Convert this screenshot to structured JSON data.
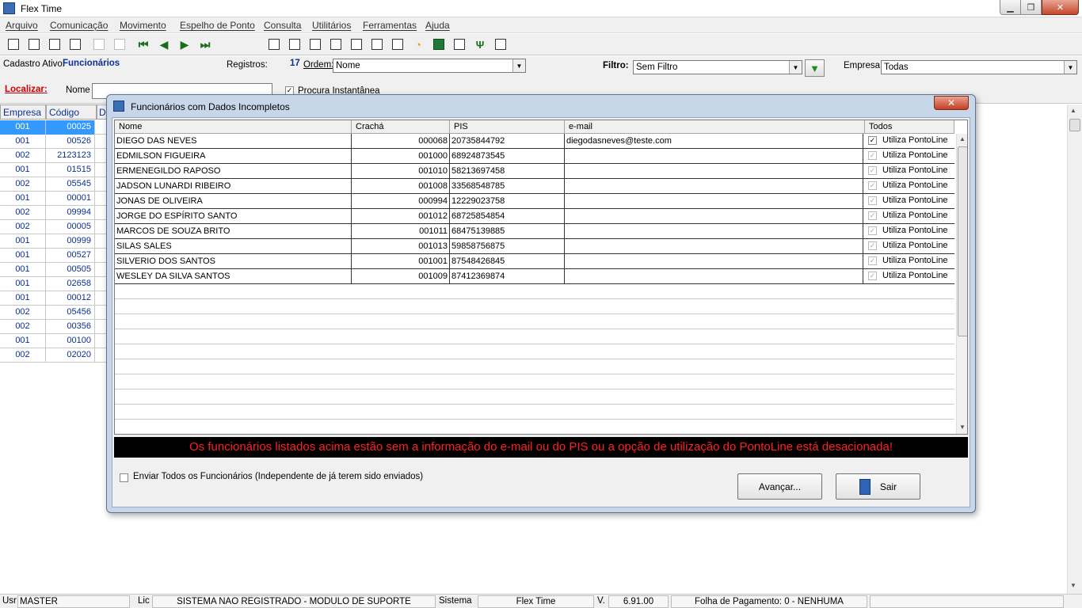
{
  "window": {
    "title": "Flex Time"
  },
  "menu": [
    "Arquivo",
    "Comunicação",
    "Movimento",
    "Espelho de Ponto",
    "Consulta",
    "Utilitários",
    "Ferramentas",
    "Ajuda"
  ],
  "row1": {
    "cadastro_label": "Cadastro Ativo:",
    "cadastro_value": "Funcionários",
    "registros_label": "Registros:",
    "registros_value": "17",
    "ordem_label": "Ordem:",
    "ordem_value": "Nome",
    "filtro_label": "Filtro:",
    "filtro_value": "Sem Filtro",
    "empresa_label": "Empresa:",
    "empresa_value": "Todas"
  },
  "row2": {
    "localizar_label": "Localizar:",
    "nome_label": "Nome",
    "nome_value": "",
    "procura_label": "Procura Instantânea"
  },
  "left_grid": {
    "headers": [
      "Empresa",
      "Código",
      "D"
    ],
    "rows": [
      [
        "001",
        "00025"
      ],
      [
        "001",
        "00526"
      ],
      [
        "002",
        "2123123"
      ],
      [
        "001",
        "01515"
      ],
      [
        "002",
        "05545"
      ],
      [
        "001",
        "00001"
      ],
      [
        "002",
        "09994"
      ],
      [
        "002",
        "00005"
      ],
      [
        "001",
        "00999"
      ],
      [
        "001",
        "00527"
      ],
      [
        "001",
        "00505"
      ],
      [
        "001",
        "02658"
      ],
      [
        "001",
        "00012"
      ],
      [
        "002",
        "05456"
      ],
      [
        "002",
        "00356"
      ],
      [
        "001",
        "00100"
      ],
      [
        "002",
        "02020"
      ]
    ]
  },
  "dialog": {
    "title": "Funcionários com Dados Incompletos",
    "columns": [
      "Nome",
      "Crachá",
      "PIS",
      "e-mail",
      "Todos"
    ],
    "rows": [
      {
        "nome": "DIEGO DAS NEVES",
        "cracha": "000068",
        "pis": "20735844792",
        "email": "diegodasneves@teste.com",
        "utiliza": "Utiliza PontoLine",
        "checked": true
      },
      {
        "nome": "EDMILSON FIGUEIRA",
        "cracha": "001000",
        "pis": "68924873545",
        "email": "",
        "utiliza": "Utiliza PontoLine",
        "checked": true
      },
      {
        "nome": "ERMENEGILDO RAPOSO",
        "cracha": "001010",
        "pis": "58213697458",
        "email": "",
        "utiliza": "Utiliza PontoLine",
        "checked": true
      },
      {
        "nome": "JADSON LUNARDI RIBEIRO",
        "cracha": "001008",
        "pis": "33568548785",
        "email": "",
        "utiliza": "Utiliza PontoLine",
        "checked": true
      },
      {
        "nome": "JONAS DE OLIVEIRA",
        "cracha": "000994",
        "pis": "12229023758",
        "email": "",
        "utiliza": "Utiliza PontoLine",
        "checked": true
      },
      {
        "nome": "JORGE DO ESPÍRITO SANTO",
        "cracha": "001012",
        "pis": "68725854854",
        "email": "",
        "utiliza": "Utiliza PontoLine",
        "checked": true
      },
      {
        "nome": "MARCOS DE SOUZA BRITO",
        "cracha": "001011",
        "pis": "68475139885",
        "email": "",
        "utiliza": "Utiliza PontoLine",
        "checked": true
      },
      {
        "nome": "SILAS SALES",
        "cracha": "001013",
        "pis": "59858756875",
        "email": "",
        "utiliza": "Utiliza PontoLine",
        "checked": true
      },
      {
        "nome": "SILVERIO DOS SANTOS",
        "cracha": "001001",
        "pis": "87548426845",
        "email": "",
        "utiliza": "Utiliza PontoLine",
        "checked": true
      },
      {
        "nome": "WESLEY DA SILVA SANTOS",
        "cracha": "001009",
        "pis": "87412369874",
        "email": "",
        "utiliza": "Utiliza PontoLine",
        "checked": true
      }
    ],
    "message": "Os funcionários listados acima estão sem a informação do e-mail ou do PIS ou a opção de utilização  do PontoLine está desacionada!",
    "send_all_label": "Enviar Todos os Funcionários (Independente de já terem sido enviados)",
    "avancar_label": "Avançar...",
    "sair_label": "Sair",
    "close_glyph": "✕"
  },
  "status": {
    "usr_label": "Usr",
    "usr_value": "MASTER",
    "lic_label": "Lic",
    "lic_value": "SISTEMA NAO REGISTRADO - MODULO DE SUPORTE",
    "sistema_label": "Sistema",
    "sistema_value": "Flex Time",
    "versao_label": "V.",
    "versao_value": "6.91.00",
    "folha_value": "Folha de Pagamento: 0 - NENHUMA"
  },
  "colors": {
    "selection": "#3399ff",
    "link_blue": "#0b2f9a",
    "message_red": "#ff2020",
    "localizar_red": "#cc0000"
  }
}
